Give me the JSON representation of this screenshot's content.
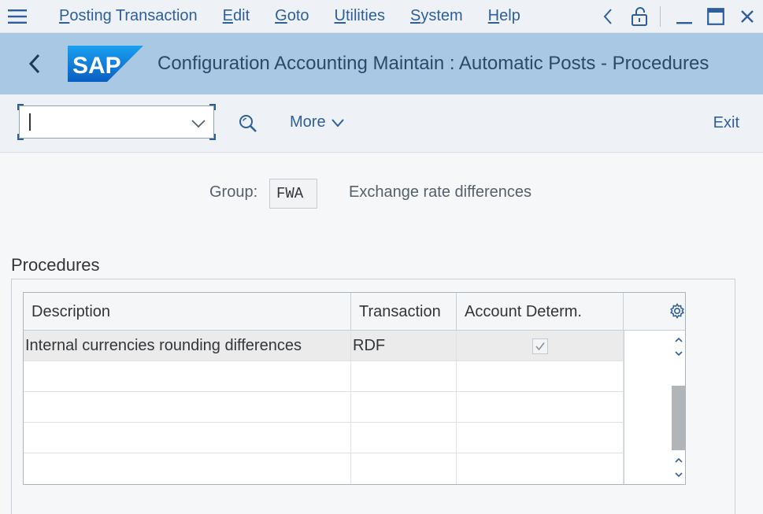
{
  "menubar": {
    "items": [
      {
        "label": "Posting Transaction"
      },
      {
        "label": "Edit"
      },
      {
        "label": "Goto"
      },
      {
        "label": "Utilities"
      },
      {
        "label": "System"
      },
      {
        "label": "Help"
      }
    ],
    "icons": [
      "hamburger-icon",
      "chevron-left-icon",
      "lock-icon",
      "minimize-icon",
      "maximize-icon",
      "close-icon"
    ]
  },
  "header": {
    "logo_text": "SAP",
    "title": "Configuration Accounting Maintain : Automatic Posts - Procedures",
    "brand_color": "#0a6ed1",
    "bar_color": "#a8c8e3"
  },
  "toolbar": {
    "command_value": "",
    "more_label": "More",
    "exit_label": "Exit"
  },
  "form": {
    "group_label": "Group:",
    "group_value": "FWA",
    "group_description": "Exchange rate differences"
  },
  "procedures": {
    "title": "Procedures",
    "columns": [
      "Description",
      "Transaction",
      "Account Determ."
    ],
    "rows": [
      {
        "description": "Internal currencies rounding differences",
        "transaction": "RDF",
        "account_determ": true
      }
    ]
  }
}
